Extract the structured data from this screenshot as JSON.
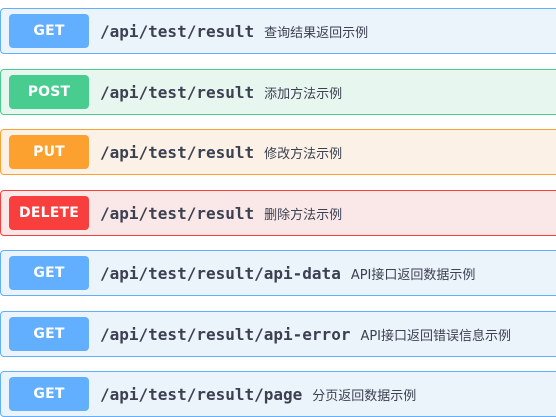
{
  "operations": [
    {
      "method": "GET",
      "path": "/api/test/result",
      "summary": "查询结果返回示例"
    },
    {
      "method": "POST",
      "path": "/api/test/result",
      "summary": "添加方法示例"
    },
    {
      "method": "PUT",
      "path": "/api/test/result",
      "summary": "修改方法示例"
    },
    {
      "method": "DELETE",
      "path": "/api/test/result",
      "summary": "删除方法示例"
    },
    {
      "method": "GET",
      "path": "/api/test/result/api-data",
      "summary": "API接口返回数据示例"
    },
    {
      "method": "GET",
      "path": "/api/test/result/api-error",
      "summary": "API接口返回错误信息示例"
    },
    {
      "method": "GET",
      "path": "/api/test/result/page",
      "summary": "分页返回数据示例"
    }
  ],
  "colors": {
    "get": "#61affe",
    "post": "#49cc90",
    "put": "#fca130",
    "delete": "#f93e3e"
  }
}
